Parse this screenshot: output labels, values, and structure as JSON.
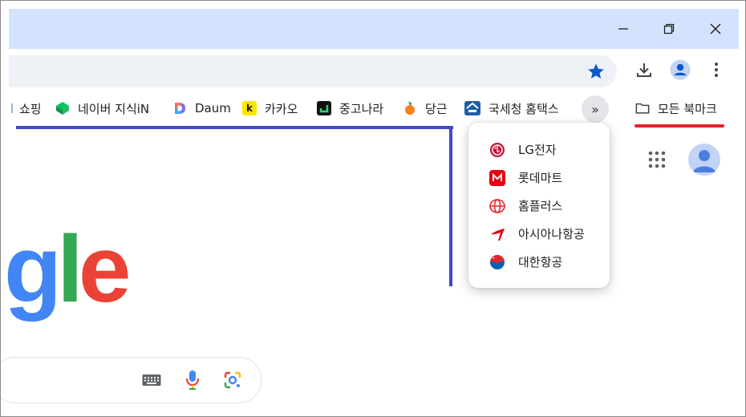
{
  "window": {
    "minimize_icon": "minimize-icon",
    "restore_icon": "restore-icon",
    "close_icon": "close-icon"
  },
  "toolbar": {
    "bookmark_star_icon": "star-icon",
    "download_icon": "download-icon",
    "profile_icon": "profile-icon",
    "menu_icon": "more-vert-icon"
  },
  "bookmarks": {
    "items": [
      {
        "label": "쇼핑",
        "icon": "shopping-icon"
      },
      {
        "label": "네이버 지식iN",
        "icon": "naver-kin-icon"
      },
      {
        "label": "Daum",
        "icon": "daum-icon"
      },
      {
        "label": "카카오",
        "icon": "kakao-icon"
      },
      {
        "label": "중고나라",
        "icon": "joonggonara-icon"
      },
      {
        "label": "당근",
        "icon": "carrot-icon"
      },
      {
        "label": "국세청 홈택스",
        "icon": "hometax-icon"
      }
    ],
    "more_label": "»",
    "all_bookmarks_label": "모든 북마크"
  },
  "overflow_menu": {
    "items": [
      {
        "label": "LG전자",
        "icon": "lg-icon"
      },
      {
        "label": "롯데마트",
        "icon": "lottemart-icon"
      },
      {
        "label": "홈플러스",
        "icon": "homeplus-icon"
      },
      {
        "label": "아시아나항공",
        "icon": "asiana-icon"
      },
      {
        "label": "대한항공",
        "icon": "koreanair-icon"
      }
    ]
  },
  "page": {
    "logo_parts": [
      "g",
      "l",
      "e"
    ],
    "colors": {
      "accent_blue": "#4348c4",
      "accent_red": "#e8202a",
      "titlebar": "#d3e3fd"
    },
    "search_icons": [
      "keyboard-icon",
      "mic-icon",
      "lens-icon"
    ]
  }
}
